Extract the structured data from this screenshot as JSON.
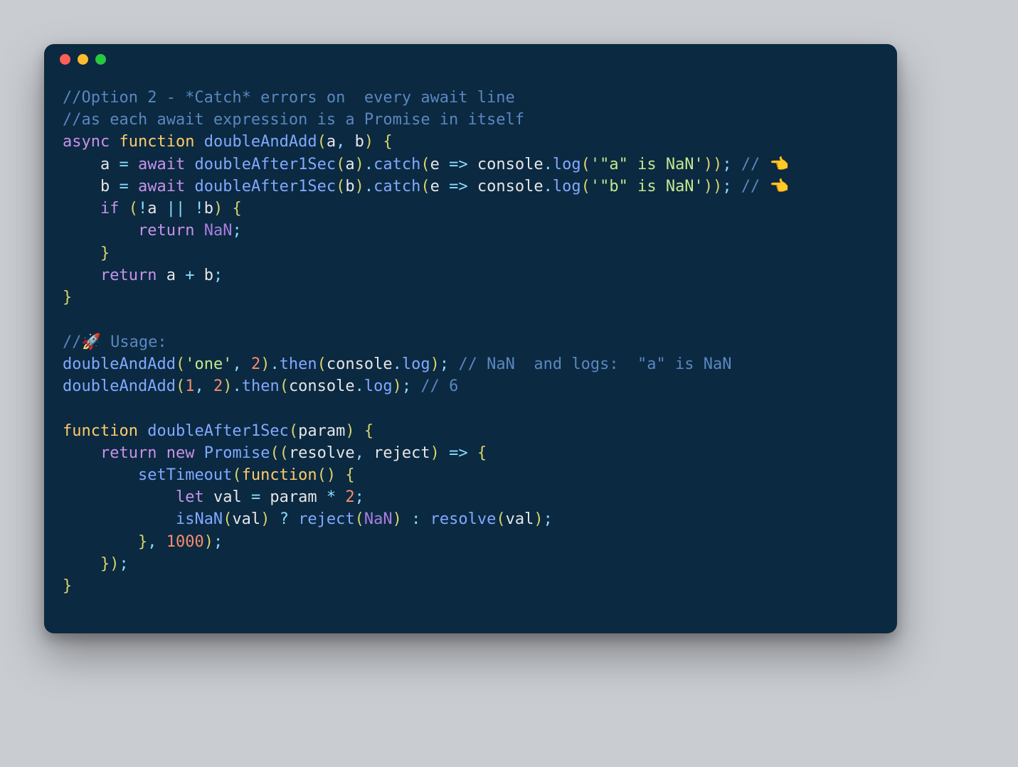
{
  "colors": {
    "bg": "#c9ccd1",
    "window": "#0b2941",
    "dot_red": "#ff5f57",
    "dot_yellow": "#febc2e",
    "dot_green": "#28c840",
    "comment": "#5a87bf",
    "keyword": "#c792ea",
    "function": "#81a9ff",
    "declaration": "#ffcb6b",
    "string": "#c3e88d",
    "number": "#f78c6c",
    "constant": "#aa7ee0",
    "operator": "#89ddff",
    "identifier": "#e6e6e6",
    "paren": "#d9d36a"
  },
  "code_lines": [
    [
      {
        "t": "//Option 2 - *Catch* errors on  every await line",
        "c": "comment"
      }
    ],
    [
      {
        "t": "//as each await expression is a Promise in itself",
        "c": "comment"
      }
    ],
    [
      {
        "t": "async",
        "c": "kw"
      },
      {
        "t": " ",
        "c": "ident"
      },
      {
        "t": "function",
        "c": "decl"
      },
      {
        "t": " ",
        "c": "ident"
      },
      {
        "t": "doubleAndAdd",
        "c": "fn"
      },
      {
        "t": "(",
        "c": "paren"
      },
      {
        "t": "a",
        "c": "ident"
      },
      {
        "t": ",",
        "c": "op"
      },
      {
        "t": " b",
        "c": "ident"
      },
      {
        "t": ")",
        "c": "paren"
      },
      {
        "t": " ",
        "c": "ident"
      },
      {
        "t": "{",
        "c": "paren"
      }
    ],
    [
      {
        "t": "    a ",
        "c": "ident"
      },
      {
        "t": "=",
        "c": "op"
      },
      {
        "t": " ",
        "c": "ident"
      },
      {
        "t": "await",
        "c": "kw"
      },
      {
        "t": " ",
        "c": "ident"
      },
      {
        "t": "doubleAfter1Sec",
        "c": "fn"
      },
      {
        "t": "(",
        "c": "paren"
      },
      {
        "t": "a",
        "c": "ident"
      },
      {
        "t": ")",
        "c": "paren"
      },
      {
        "t": ".",
        "c": "op"
      },
      {
        "t": "catch",
        "c": "fn"
      },
      {
        "t": "(",
        "c": "paren"
      },
      {
        "t": "e ",
        "c": "ident"
      },
      {
        "t": "=>",
        "c": "op"
      },
      {
        "t": " console",
        "c": "ident"
      },
      {
        "t": ".",
        "c": "op"
      },
      {
        "t": "log",
        "c": "fn"
      },
      {
        "t": "(",
        "c": "paren"
      },
      {
        "t": "'\"a\" is NaN'",
        "c": "str"
      },
      {
        "t": "))",
        "c": "paren"
      },
      {
        "t": ";",
        "c": "op"
      },
      {
        "t": " ",
        "c": "ident"
      },
      {
        "t": "// ",
        "c": "comment"
      },
      {
        "t": "👈",
        "c": "emoji"
      }
    ],
    [
      {
        "t": "    b ",
        "c": "ident"
      },
      {
        "t": "=",
        "c": "op"
      },
      {
        "t": " ",
        "c": "ident"
      },
      {
        "t": "await",
        "c": "kw"
      },
      {
        "t": " ",
        "c": "ident"
      },
      {
        "t": "doubleAfter1Sec",
        "c": "fn"
      },
      {
        "t": "(",
        "c": "paren"
      },
      {
        "t": "b",
        "c": "ident"
      },
      {
        "t": ")",
        "c": "paren"
      },
      {
        "t": ".",
        "c": "op"
      },
      {
        "t": "catch",
        "c": "fn"
      },
      {
        "t": "(",
        "c": "paren"
      },
      {
        "t": "e ",
        "c": "ident"
      },
      {
        "t": "=>",
        "c": "op"
      },
      {
        "t": " console",
        "c": "ident"
      },
      {
        "t": ".",
        "c": "op"
      },
      {
        "t": "log",
        "c": "fn"
      },
      {
        "t": "(",
        "c": "paren"
      },
      {
        "t": "'\"b\" is NaN'",
        "c": "str"
      },
      {
        "t": "))",
        "c": "paren"
      },
      {
        "t": ";",
        "c": "op"
      },
      {
        "t": " ",
        "c": "ident"
      },
      {
        "t": "// ",
        "c": "comment"
      },
      {
        "t": "👈",
        "c": "emoji"
      }
    ],
    [
      {
        "t": "    ",
        "c": "ident"
      },
      {
        "t": "if",
        "c": "kw"
      },
      {
        "t": " ",
        "c": "ident"
      },
      {
        "t": "(",
        "c": "paren"
      },
      {
        "t": "!",
        "c": "op"
      },
      {
        "t": "a ",
        "c": "ident"
      },
      {
        "t": "||",
        "c": "op"
      },
      {
        "t": " ",
        "c": "ident"
      },
      {
        "t": "!",
        "c": "op"
      },
      {
        "t": "b",
        "c": "ident"
      },
      {
        "t": ")",
        "c": "paren"
      },
      {
        "t": " ",
        "c": "ident"
      },
      {
        "t": "{",
        "c": "paren"
      }
    ],
    [
      {
        "t": "        ",
        "c": "ident"
      },
      {
        "t": "return",
        "c": "kw"
      },
      {
        "t": " ",
        "c": "ident"
      },
      {
        "t": "NaN",
        "c": "const"
      },
      {
        "t": ";",
        "c": "op"
      }
    ],
    [
      {
        "t": "    ",
        "c": "ident"
      },
      {
        "t": "}",
        "c": "paren"
      }
    ],
    [
      {
        "t": "    ",
        "c": "ident"
      },
      {
        "t": "return",
        "c": "kw"
      },
      {
        "t": " a ",
        "c": "ident"
      },
      {
        "t": "+",
        "c": "op"
      },
      {
        "t": " b",
        "c": "ident"
      },
      {
        "t": ";",
        "c": "op"
      }
    ],
    [
      {
        "t": "}",
        "c": "paren"
      }
    ],
    [],
    [
      {
        "t": "//",
        "c": "comment"
      },
      {
        "t": "🚀",
        "c": "emoji"
      },
      {
        "t": " Usage:",
        "c": "comment"
      }
    ],
    [
      {
        "t": "doubleAndAdd",
        "c": "fn"
      },
      {
        "t": "(",
        "c": "paren"
      },
      {
        "t": "'one'",
        "c": "str"
      },
      {
        "t": ",",
        "c": "op"
      },
      {
        "t": " ",
        "c": "ident"
      },
      {
        "t": "2",
        "c": "num"
      },
      {
        "t": ")",
        "c": "paren"
      },
      {
        "t": ".",
        "c": "op"
      },
      {
        "t": "then",
        "c": "fn"
      },
      {
        "t": "(",
        "c": "paren"
      },
      {
        "t": "console",
        "c": "ident"
      },
      {
        "t": ".",
        "c": "op"
      },
      {
        "t": "log",
        "c": "fn"
      },
      {
        "t": ")",
        "c": "paren"
      },
      {
        "t": ";",
        "c": "op"
      },
      {
        "t": " ",
        "c": "ident"
      },
      {
        "t": "// NaN  and logs:  \"a\" is NaN",
        "c": "comment"
      }
    ],
    [
      {
        "t": "doubleAndAdd",
        "c": "fn"
      },
      {
        "t": "(",
        "c": "paren"
      },
      {
        "t": "1",
        "c": "num"
      },
      {
        "t": ",",
        "c": "op"
      },
      {
        "t": " ",
        "c": "ident"
      },
      {
        "t": "2",
        "c": "num"
      },
      {
        "t": ")",
        "c": "paren"
      },
      {
        "t": ".",
        "c": "op"
      },
      {
        "t": "then",
        "c": "fn"
      },
      {
        "t": "(",
        "c": "paren"
      },
      {
        "t": "console",
        "c": "ident"
      },
      {
        "t": ".",
        "c": "op"
      },
      {
        "t": "log",
        "c": "fn"
      },
      {
        "t": ")",
        "c": "paren"
      },
      {
        "t": ";",
        "c": "op"
      },
      {
        "t": " ",
        "c": "ident"
      },
      {
        "t": "// 6",
        "c": "comment"
      }
    ],
    [],
    [
      {
        "t": "function",
        "c": "decl"
      },
      {
        "t": " ",
        "c": "ident"
      },
      {
        "t": "doubleAfter1Sec",
        "c": "fn"
      },
      {
        "t": "(",
        "c": "paren"
      },
      {
        "t": "param",
        "c": "ident"
      },
      {
        "t": ")",
        "c": "paren"
      },
      {
        "t": " ",
        "c": "ident"
      },
      {
        "t": "{",
        "c": "paren"
      }
    ],
    [
      {
        "t": "    ",
        "c": "ident"
      },
      {
        "t": "return",
        "c": "kw"
      },
      {
        "t": " ",
        "c": "ident"
      },
      {
        "t": "new",
        "c": "kw"
      },
      {
        "t": " ",
        "c": "ident"
      },
      {
        "t": "Promise",
        "c": "fn"
      },
      {
        "t": "((",
        "c": "paren"
      },
      {
        "t": "resolve",
        "c": "ident"
      },
      {
        "t": ",",
        "c": "op"
      },
      {
        "t": " reject",
        "c": "ident"
      },
      {
        "t": ")",
        "c": "paren"
      },
      {
        "t": " ",
        "c": "ident"
      },
      {
        "t": "=>",
        "c": "op"
      },
      {
        "t": " ",
        "c": "ident"
      },
      {
        "t": "{",
        "c": "paren"
      }
    ],
    [
      {
        "t": "        ",
        "c": "ident"
      },
      {
        "t": "setTimeout",
        "c": "fn"
      },
      {
        "t": "(",
        "c": "paren"
      },
      {
        "t": "function",
        "c": "decl"
      },
      {
        "t": "()",
        "c": "paren"
      },
      {
        "t": " ",
        "c": "ident"
      },
      {
        "t": "{",
        "c": "paren"
      }
    ],
    [
      {
        "t": "            ",
        "c": "ident"
      },
      {
        "t": "let",
        "c": "kw"
      },
      {
        "t": " val ",
        "c": "ident"
      },
      {
        "t": "=",
        "c": "op"
      },
      {
        "t": " param ",
        "c": "ident"
      },
      {
        "t": "*",
        "c": "op"
      },
      {
        "t": " ",
        "c": "ident"
      },
      {
        "t": "2",
        "c": "num"
      },
      {
        "t": ";",
        "c": "op"
      }
    ],
    [
      {
        "t": "            ",
        "c": "ident"
      },
      {
        "t": "isNaN",
        "c": "fn"
      },
      {
        "t": "(",
        "c": "paren"
      },
      {
        "t": "val",
        "c": "ident"
      },
      {
        "t": ")",
        "c": "paren"
      },
      {
        "t": " ",
        "c": "ident"
      },
      {
        "t": "?",
        "c": "op"
      },
      {
        "t": " ",
        "c": "ident"
      },
      {
        "t": "reject",
        "c": "fn"
      },
      {
        "t": "(",
        "c": "paren"
      },
      {
        "t": "NaN",
        "c": "const"
      },
      {
        "t": ")",
        "c": "paren"
      },
      {
        "t": " ",
        "c": "ident"
      },
      {
        "t": ":",
        "c": "op"
      },
      {
        "t": " ",
        "c": "ident"
      },
      {
        "t": "resolve",
        "c": "fn"
      },
      {
        "t": "(",
        "c": "paren"
      },
      {
        "t": "val",
        "c": "ident"
      },
      {
        "t": ")",
        "c": "paren"
      },
      {
        "t": ";",
        "c": "op"
      }
    ],
    [
      {
        "t": "        ",
        "c": "ident"
      },
      {
        "t": "}",
        "c": "paren"
      },
      {
        "t": ",",
        "c": "op"
      },
      {
        "t": " ",
        "c": "ident"
      },
      {
        "t": "1000",
        "c": "num"
      },
      {
        "t": ")",
        "c": "paren"
      },
      {
        "t": ";",
        "c": "op"
      }
    ],
    [
      {
        "t": "    ",
        "c": "ident"
      },
      {
        "t": "})",
        "c": "paren"
      },
      {
        "t": ";",
        "c": "op"
      }
    ],
    [
      {
        "t": "}",
        "c": "paren"
      }
    ]
  ]
}
